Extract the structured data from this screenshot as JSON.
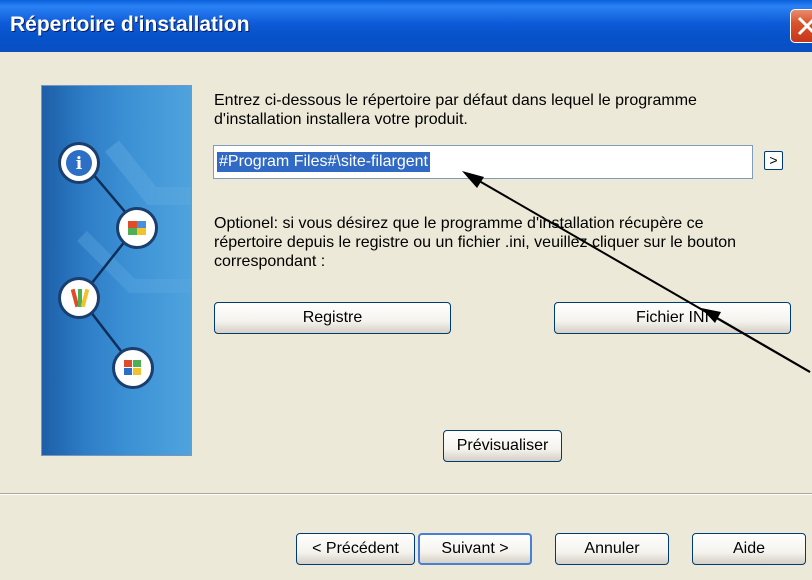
{
  "window": {
    "title": "Répertoire d'installation"
  },
  "instructions": {
    "line1": "Entrez ci-dessous le répertoire par défaut dans lequel le programme",
    "line2": "d'installation installera votre produit."
  },
  "directory_input": {
    "value": "#Program Files#\\site-filargent"
  },
  "browse_button": {
    "label": ">"
  },
  "optional_text": {
    "line1": "Optionel: si vous désirez que le programme d'installation récupère ce",
    "line2": "répertoire depuis le registre ou un fichier .ini, veuillez cliquer sur le bouton",
    "line3": "correspondant :"
  },
  "buttons": {
    "registry": "Registre",
    "ini_file": "Fichier INI",
    "preview": "Prévisualiser",
    "previous": "< Précédent",
    "next": "Suivant >",
    "cancel": "Annuler",
    "help": "Aide"
  },
  "icons": [
    "info-icon",
    "window-icon",
    "tools-icon",
    "windows-logo-icon"
  ],
  "colors": {
    "titlebar": "#0A4FC2",
    "selection": "#316AC5",
    "background": "#ECE9D8"
  }
}
